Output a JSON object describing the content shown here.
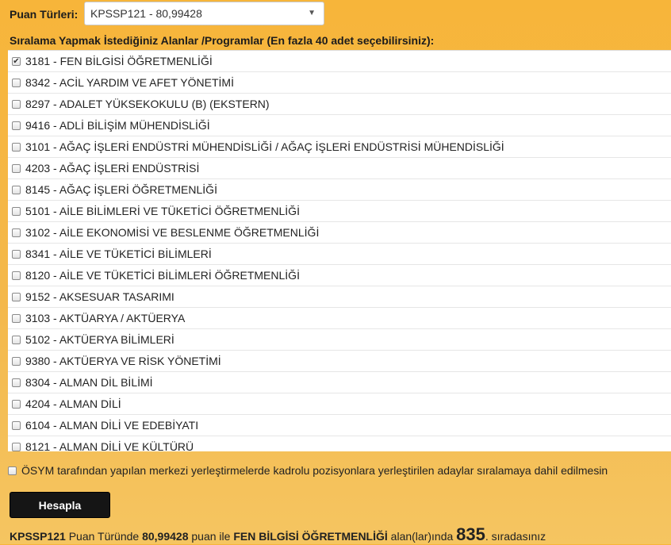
{
  "header": {
    "puan_label": "Puan Türleri:",
    "selected_puan": "KPSSP121 - 80,99428",
    "list_heading": "Sıralama Yapmak İstediğiniz Alanlar /Programlar (En fazla 40 adet seçebilirsiniz):"
  },
  "programs": [
    {
      "label": "3181 - FEN BİLGİSİ ÖĞRETMENLİĞİ",
      "checked": true
    },
    {
      "label": "8342 - ACİL YARDIM VE AFET YÖNETİMİ",
      "checked": false
    },
    {
      "label": "8297 - ADALET YÜKSEKOKULU (B) (EKSTERN)",
      "checked": false
    },
    {
      "label": "9416 - ADLİ BİLİŞİM MÜHENDİSLİĞİ",
      "checked": false
    },
    {
      "label": "3101 - AĞAÇ İŞLERİ ENDÜSTRİ MÜHENDİSLİĞİ / AĞAÇ İŞLERİ ENDÜSTRİSİ MÜHENDİSLİĞİ",
      "checked": false
    },
    {
      "label": "4203 - AĞAÇ İŞLERİ ENDÜSTRİSİ",
      "checked": false
    },
    {
      "label": "8145 - AĞAÇ İŞLERİ ÖĞRETMENLİĞİ",
      "checked": false
    },
    {
      "label": "5101 - AİLE BİLİMLERİ VE TÜKETİCİ ÖĞRETMENLİĞİ",
      "checked": false
    },
    {
      "label": "3102 - AİLE EKONOMİSİ VE BESLENME ÖĞRETMENLİĞİ",
      "checked": false
    },
    {
      "label": "8341 - AİLE VE TÜKETİCİ BİLİMLERİ",
      "checked": false
    },
    {
      "label": "8120 - AİLE VE TÜKETİCİ BİLİMLERİ ÖĞRETMENLİĞİ",
      "checked": false
    },
    {
      "label": "9152 - AKSESUAR TASARIMI",
      "checked": false
    },
    {
      "label": "3103 - AKTÜARYA / AKTÜERYA",
      "checked": false
    },
    {
      "label": "5102 - AKTÜERYA BİLİMLERİ",
      "checked": false
    },
    {
      "label": "9380 - AKTÜERYA VE RİSK YÖNETİMİ",
      "checked": false
    },
    {
      "label": "8304 - ALMAN DİL BİLİMİ",
      "checked": false
    },
    {
      "label": "4204 - ALMAN DİLİ",
      "checked": false
    },
    {
      "label": "6104 - ALMAN DİLİ VE EDEBİYATI",
      "checked": false
    },
    {
      "label": "8121 - ALMAN DİLİ VE KÜLTÜRÜ",
      "checked": false
    }
  ],
  "options": {
    "exclude_label": "ÖSYM tarafından yapılan merkezi yerleştirmelerde kadrolu pozisyonlara yerleştirilen adaylar sıralamaya dahil edilmesin",
    "exclude_checked": false
  },
  "actions": {
    "calculate_label": "Hesapla"
  },
  "result": {
    "puan_type": "KPSSP121",
    "text1": " Puan Türünde ",
    "score": "80,99428",
    "text2": " puan ile ",
    "program": "FEN BİLGİSİ ÖĞRETMENLİĞİ",
    "text3": " alan(lar)ında ",
    "rank": "835",
    "text4": ". sıradasınız"
  },
  "icons": {
    "select_arrow": "chevron-down-icon",
    "check": "checkmark-icon"
  }
}
